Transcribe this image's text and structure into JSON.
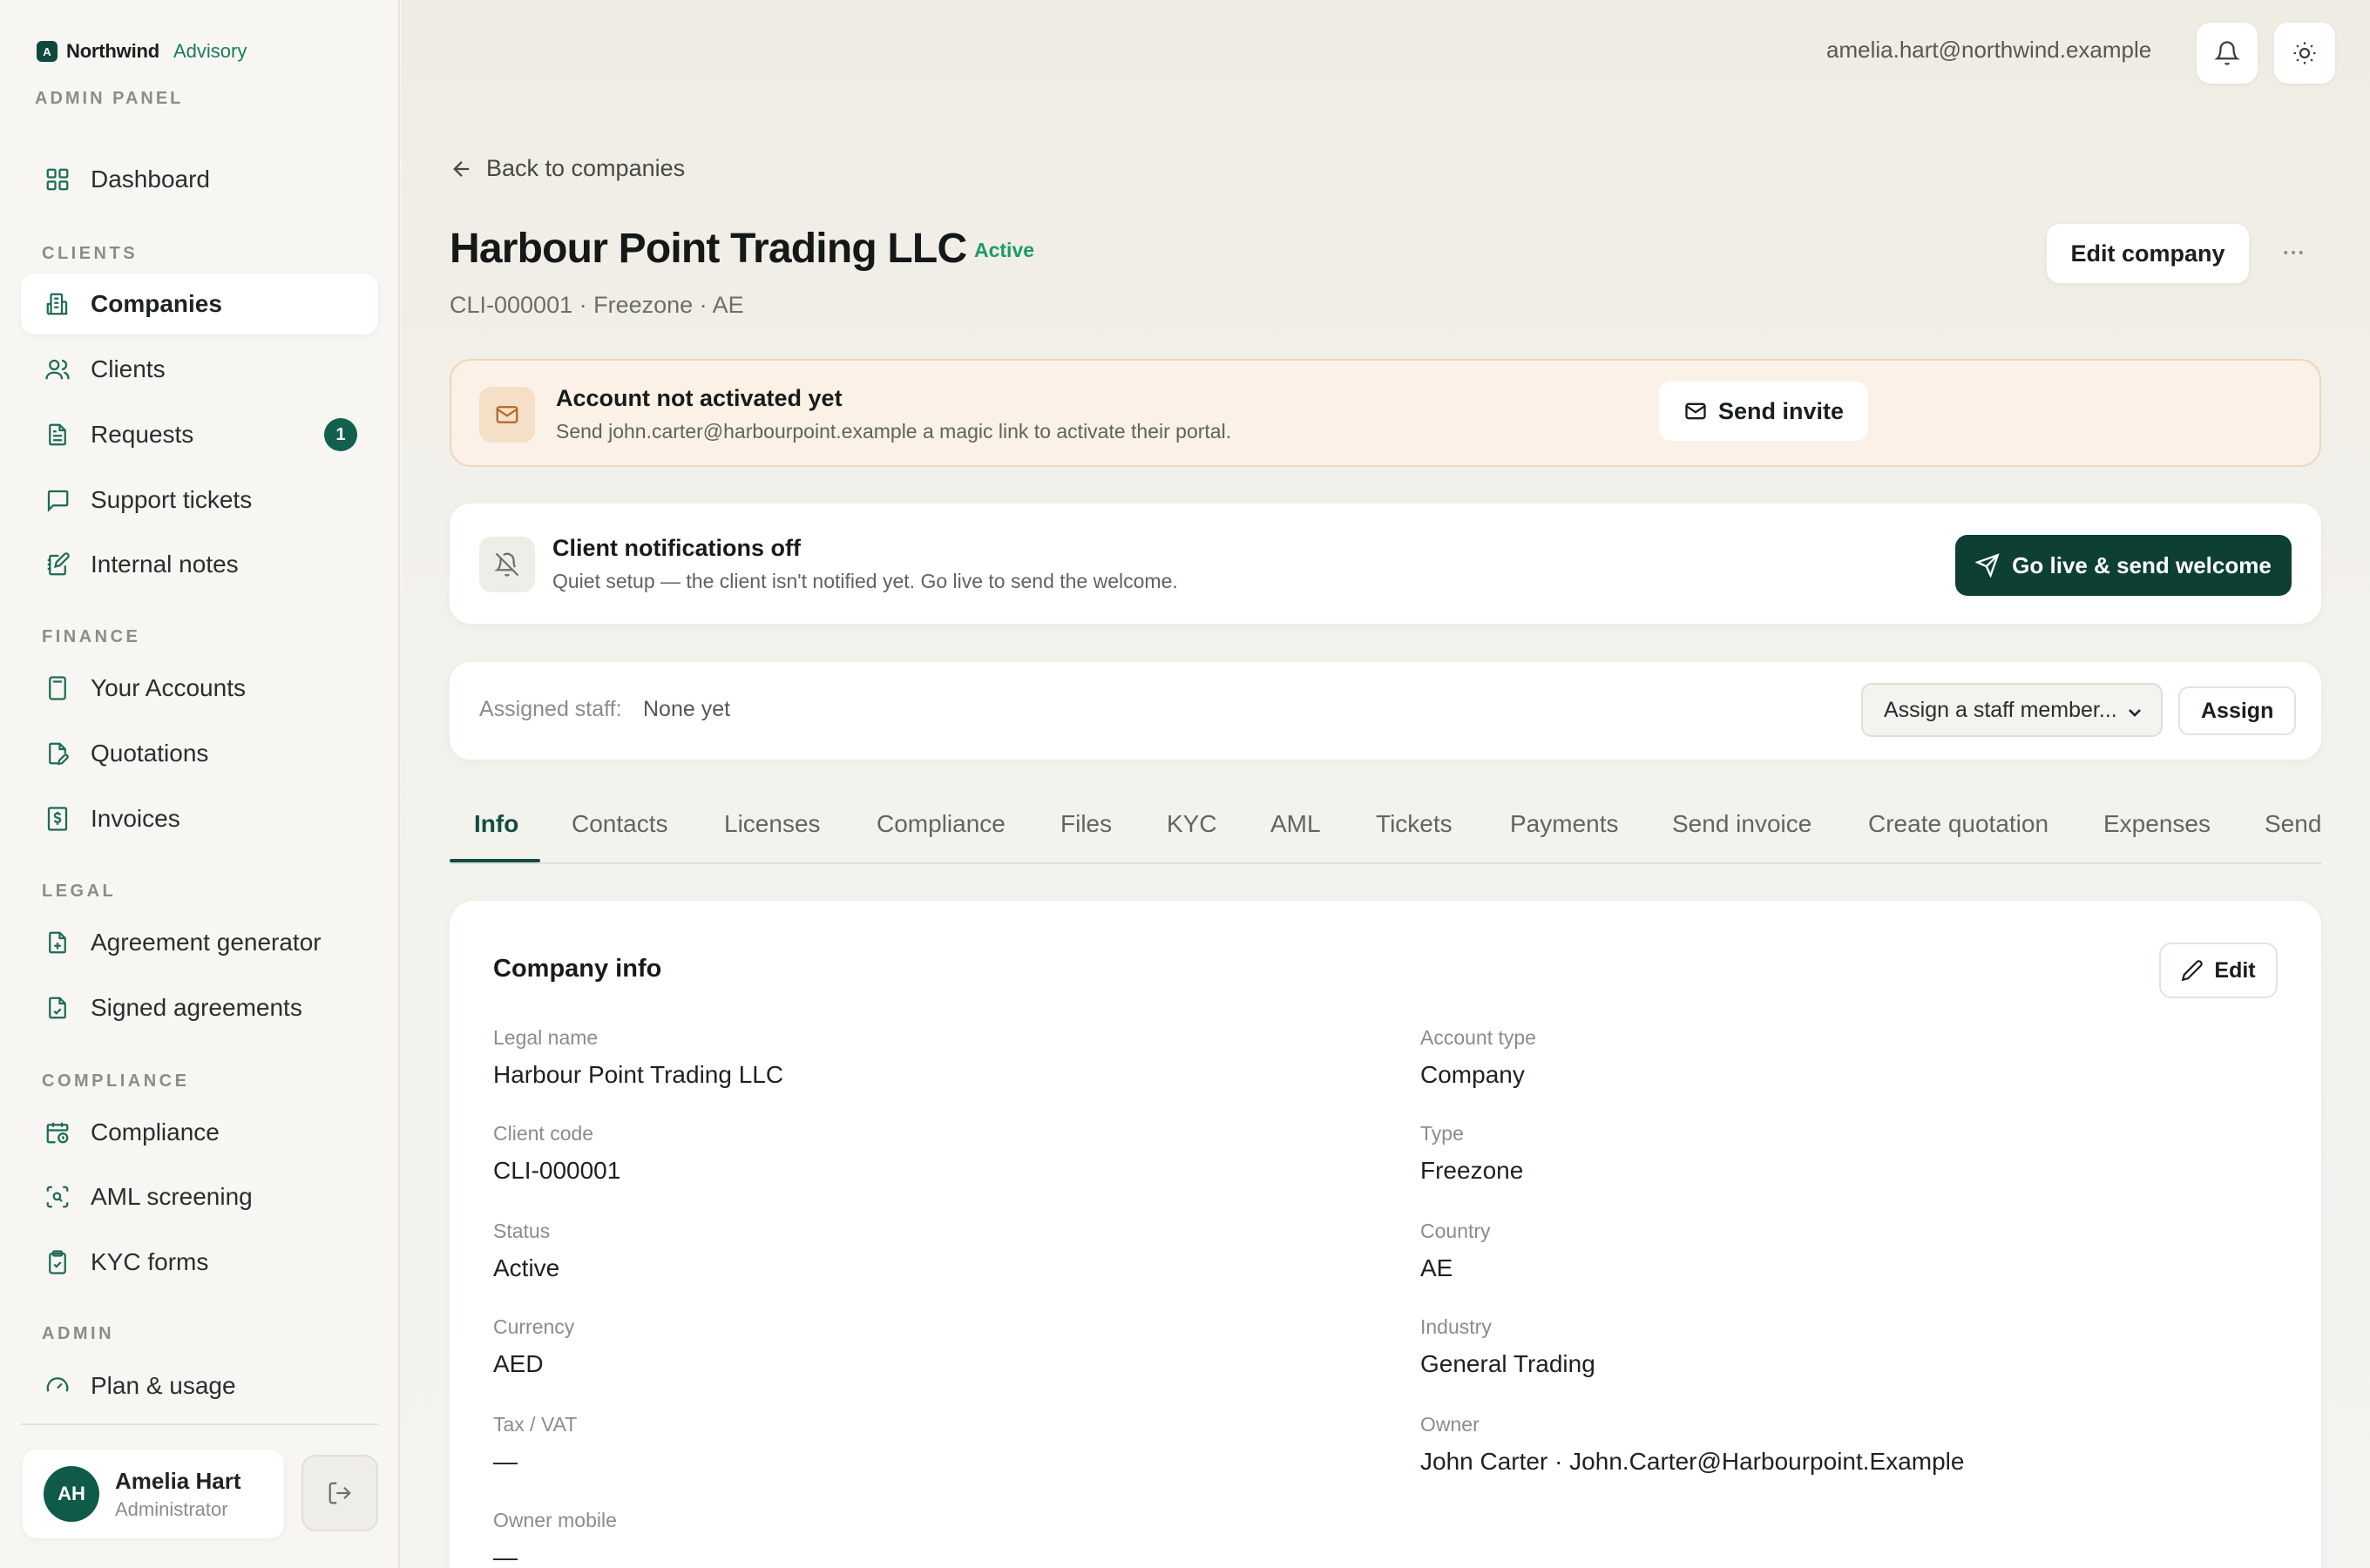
{
  "brand": {
    "name": "Northwind",
    "sub": "Advisory",
    "logo_letter": "A",
    "panel_label": "ADMIN PANEL"
  },
  "sidebar": {
    "dashboard": "Dashboard",
    "sections": {
      "clients": "CLIENTS",
      "finance": "FINANCE",
      "legal": "LEGAL",
      "compliance": "COMPLIANCE",
      "admin": "ADMIN"
    },
    "items": {
      "companies": "Companies",
      "clients": "Clients",
      "requests": "Requests",
      "requests_badge": "1",
      "support_tickets": "Support tickets",
      "internal_notes": "Internal notes",
      "your_accounts": "Your Accounts",
      "quotations": "Quotations",
      "invoices": "Invoices",
      "agreement_generator": "Agreement generator",
      "signed_agreements": "Signed agreements",
      "compliance": "Compliance",
      "aml_screening": "AML screening",
      "kyc_forms": "KYC forms",
      "plan_usage": "Plan & usage"
    },
    "active": "Companies"
  },
  "user": {
    "initials": "AH",
    "name": "Amelia Hart",
    "role": "Administrator",
    "email": "amelia.hart@northwind.example"
  },
  "page": {
    "back_label": "Back to companies",
    "title": "Harbour Point Trading LLC",
    "status": "Active",
    "meta": "CLI-000001 · Freezone · AE",
    "edit_button": "Edit company"
  },
  "activation_banner": {
    "title": "Account not activated yet",
    "desc": "Send john.carter@harbourpoint.example a magic link to activate their portal.",
    "button": "Send invite"
  },
  "notify_banner": {
    "title": "Client notifications off",
    "desc": "Quiet setup — the client isn't notified yet. Go live to send the welcome.",
    "button": "Go live & send welcome"
  },
  "assign": {
    "label": "Assigned staff:",
    "value": "None yet",
    "select_placeholder": "Assign a staff member...",
    "button": "Assign"
  },
  "tabs": [
    "Info",
    "Contacts",
    "Licenses",
    "Compliance",
    "Files",
    "KYC",
    "AML",
    "Tickets",
    "Payments",
    "Send invoice",
    "Create quotation",
    "Expenses",
    "Send"
  ],
  "active_tab": "Info",
  "info": {
    "title": "Company info",
    "edit_button": "Edit",
    "left": [
      {
        "label": "Legal name",
        "value": "Harbour Point Trading LLC"
      },
      {
        "label": "Client code",
        "value": "CLI-000001"
      },
      {
        "label": "Status",
        "value": "Active"
      },
      {
        "label": "Currency",
        "value": "AED"
      },
      {
        "label": "Tax / VAT",
        "value": "—"
      },
      {
        "label": "Owner mobile",
        "value": "—"
      }
    ],
    "right": [
      {
        "label": "Account type",
        "value": "Company"
      },
      {
        "label": "Type",
        "value": "Freezone"
      },
      {
        "label": "Country",
        "value": "AE"
      },
      {
        "label": "Industry",
        "value": "General Trading"
      },
      {
        "label": "Owner",
        "value": "John Carter · John.Carter@Harbourpoint.Example"
      }
    ]
  },
  "colors": {
    "accent": "#124d40",
    "status_green": "#1c9a6b",
    "banner_warm": "#fbf1e6"
  }
}
